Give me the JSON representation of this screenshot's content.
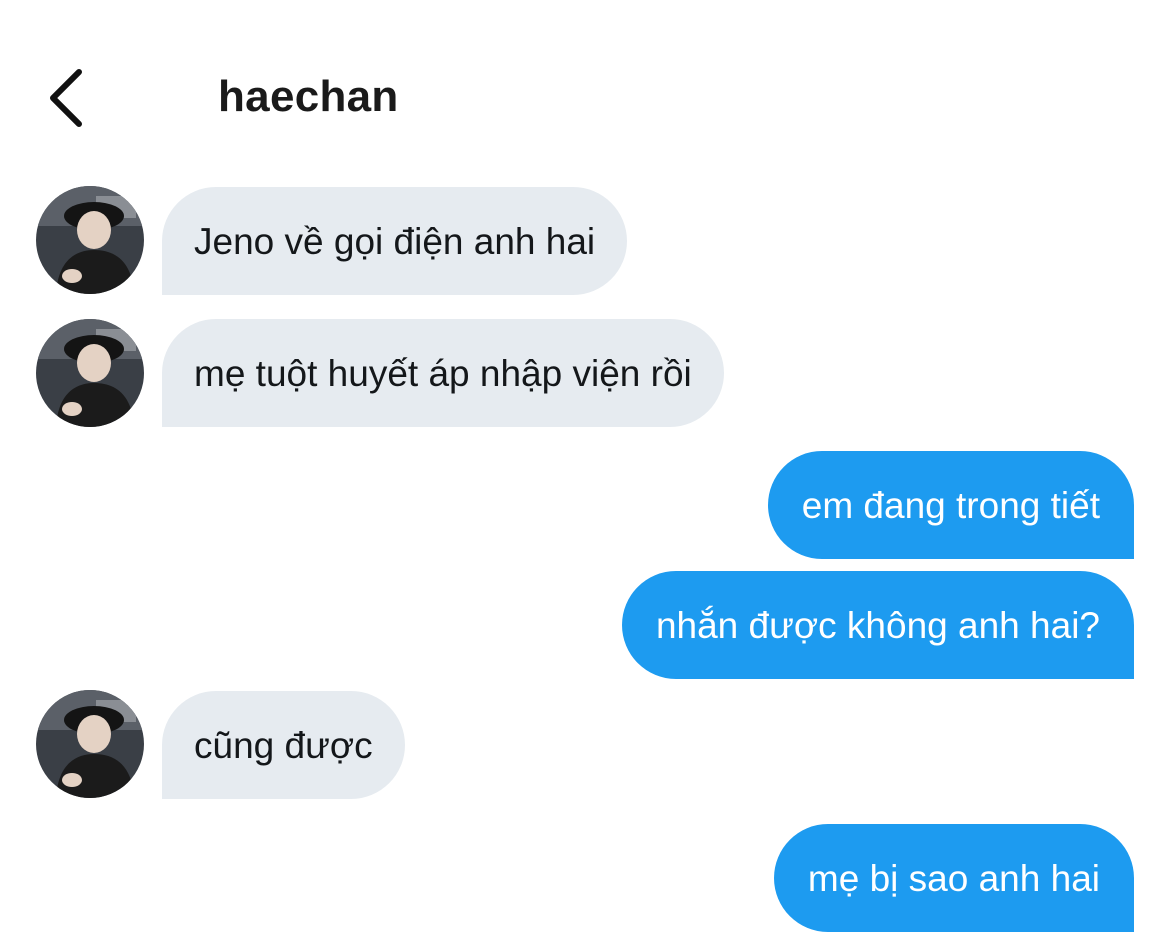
{
  "header": {
    "back_icon": "chevron-left-icon",
    "title": "haechan"
  },
  "colors": {
    "incoming_bubble": "#e6ebf0",
    "outgoing_bubble": "#1d9bf0",
    "incoming_text": "#14171a",
    "outgoing_text": "#ffffff"
  },
  "messages": [
    {
      "direction": "incoming",
      "text": "Jeno về gọi điện anh hai",
      "avatar": true
    },
    {
      "direction": "incoming",
      "text": "mẹ tuột huyết áp nhập viện rồi",
      "avatar": true
    },
    {
      "direction": "outgoing",
      "text": "em đang trong tiết"
    },
    {
      "direction": "outgoing",
      "text": "nhắn được không anh hai?"
    },
    {
      "direction": "incoming",
      "text": "cũng được",
      "avatar": true
    },
    {
      "direction": "outgoing",
      "text": "mẹ bị sao anh hai"
    }
  ]
}
